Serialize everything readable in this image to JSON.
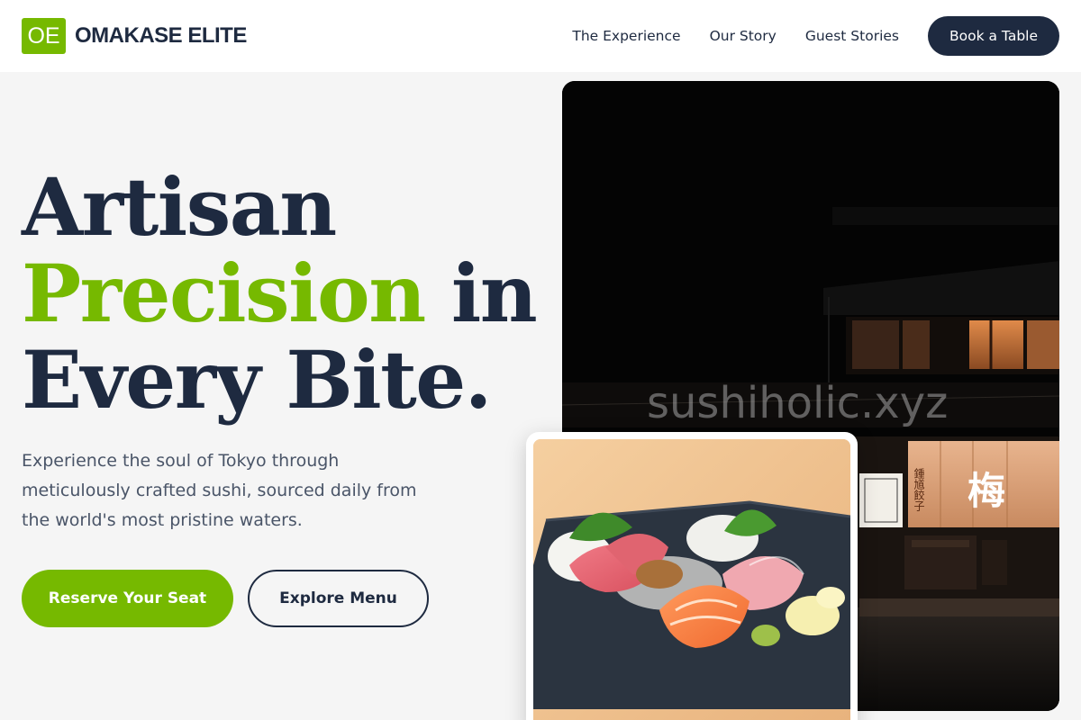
{
  "brand": {
    "logo_mark": "OE",
    "name": "OMAKASE ELITE",
    "accent_color": "#76b900",
    "dark_color": "#1e2a40"
  },
  "nav": {
    "links": [
      "The Experience",
      "Our Story",
      "Guest Stories"
    ],
    "cta": "Book a Table"
  },
  "hero": {
    "headline_1": "Artisan",
    "headline_2_accent": "Precision",
    "headline_2_rest": " in",
    "headline_3": "Every Bite.",
    "subtext": "Experience the soul of Tokyo through meticulously crafted sushi, sourced daily from the world's most pristine waters.",
    "primary_button": "Reserve Your Seat",
    "secondary_button": "Explore Menu"
  },
  "images": {
    "storefront_watermark": "sushiholic.xyz",
    "storefront_sign_char": "梅",
    "storefront_sign_small": "鍾馗餃子",
    "food_alt": "sashimi-platter-photo"
  }
}
